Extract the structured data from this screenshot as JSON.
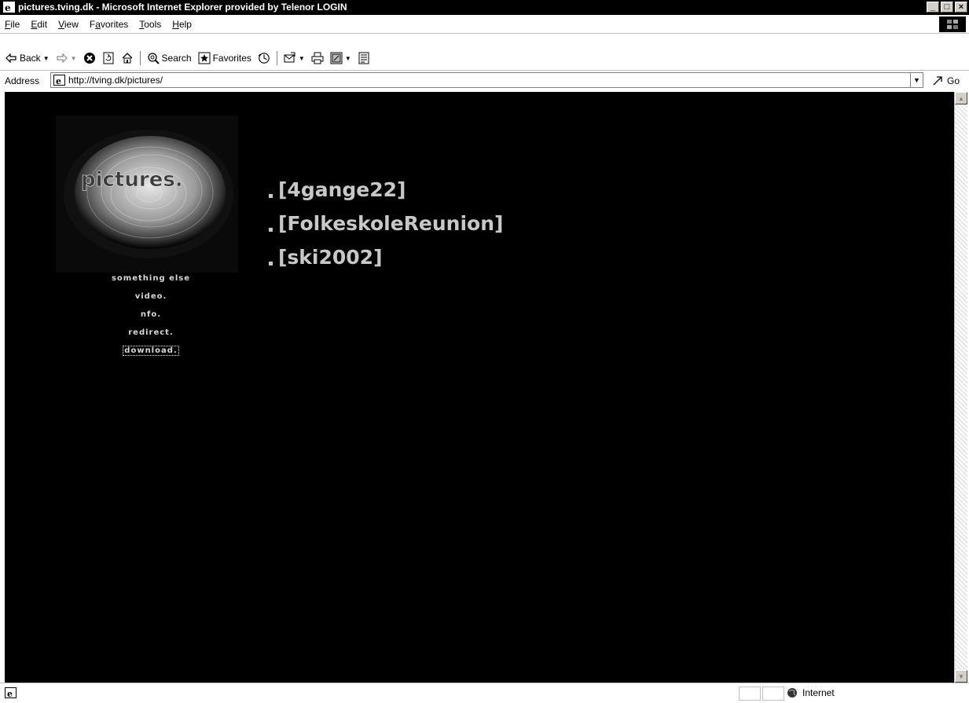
{
  "window": {
    "title": "pictures.tving.dk - Microsoft Internet Explorer provided by Telenor LOGIN",
    "buttons": {
      "minimize": "_",
      "maximize": "□",
      "close": "×"
    }
  },
  "menu": {
    "items": [
      {
        "label": "File",
        "mnemonic_index": 0
      },
      {
        "label": "Edit",
        "mnemonic_index": 0
      },
      {
        "label": "View",
        "mnemonic_index": 0
      },
      {
        "label": "Favorites",
        "mnemonic_index": 1
      },
      {
        "label": "Tools",
        "mnemonic_index": 0
      },
      {
        "label": "Help",
        "mnemonic_index": 0
      }
    ]
  },
  "toolbar": {
    "back_label": "Back",
    "search_label": "Search",
    "favorites_label": "Favorites",
    "icons": [
      "back-arrow-icon",
      "forward-arrow-icon",
      "stop-icon",
      "refresh-icon",
      "home-icon",
      "search-icon",
      "favorites-icon",
      "history-icon",
      "mail-icon",
      "print-icon",
      "edit-icon",
      "discuss-icon"
    ]
  },
  "address": {
    "label": "Address",
    "url": "http://tving.dk/pictures/",
    "go_label": "Go"
  },
  "page": {
    "logo_text": "pictures.",
    "nav": [
      {
        "label": "something else"
      },
      {
        "label": "video."
      },
      {
        "label": "nfo."
      },
      {
        "label": "redirect."
      },
      {
        "label": "download."
      }
    ],
    "gallery_links": [
      {
        "label": "[4gange22]"
      },
      {
        "label": "[FolkeskoleReunion]"
      },
      {
        "label": "[ski2002]"
      }
    ],
    "colors": {
      "background": "#000000",
      "link_text": "#c8c8c8",
      "nav_text": "#d8d8d8"
    }
  },
  "statusbar": {
    "zone_label": "Internet"
  }
}
